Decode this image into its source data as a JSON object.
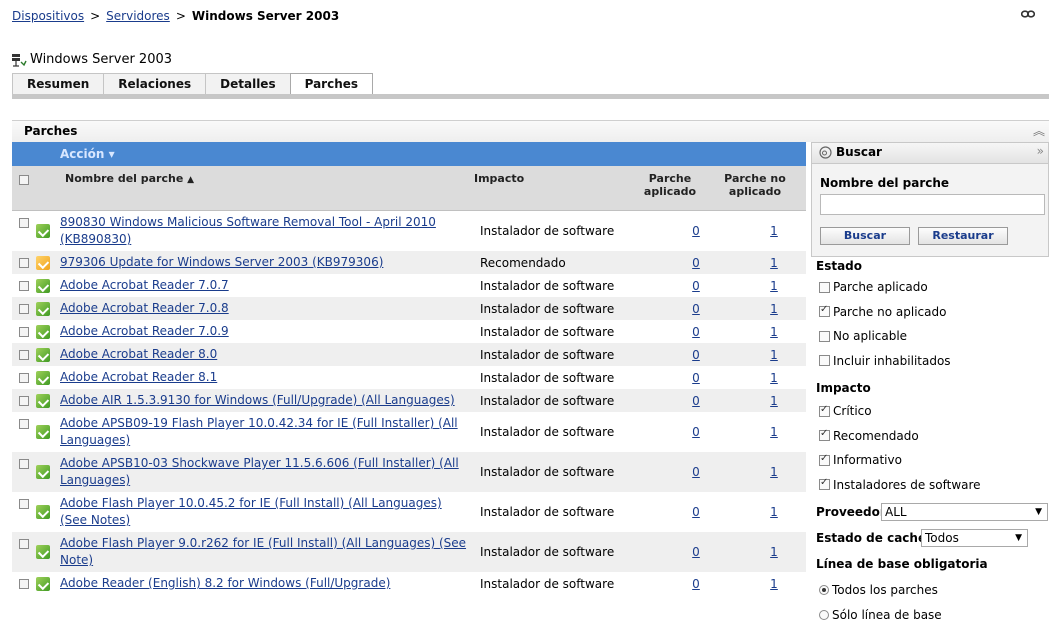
{
  "breadcrumb": {
    "item1": "Dispositivos",
    "item2": "Servidores",
    "current": "Windows Server 2003",
    "sep": ">"
  },
  "device": {
    "title": "Windows Server 2003"
  },
  "tabs": [
    "Resumen",
    "Relaciones",
    "Detalles",
    "Parches"
  ],
  "active_tab": "Parches",
  "panel": {
    "title": "Parches"
  },
  "table": {
    "action_label": "Acción ▾",
    "columns": {
      "name": "Nombre del parche",
      "sort": "▲",
      "impact": "Impacto",
      "applied": "Parche aplicado",
      "not_applied": "Parche no aplicado"
    },
    "rows": [
      {
        "name": "890830 Windows Malicious Software Removal Tool - April 2010 (KB890830)",
        "impact": "Instalador de software",
        "applied": "0",
        "not_applied": "1",
        "icon": "green"
      },
      {
        "name": "979306 Update for Windows Server 2003 (KB979306)",
        "impact": "Recomendado",
        "applied": "0",
        "not_applied": "1",
        "icon": "orange"
      },
      {
        "name": "Adobe Acrobat Reader 7.0.7",
        "impact": "Instalador de software",
        "applied": "0",
        "not_applied": "1",
        "icon": "green"
      },
      {
        "name": "Adobe Acrobat Reader 7.0.8",
        "impact": "Instalador de software",
        "applied": "0",
        "not_applied": "1",
        "icon": "green"
      },
      {
        "name": "Adobe Acrobat Reader 7.0.9",
        "impact": "Instalador de software",
        "applied": "0",
        "not_applied": "1",
        "icon": "green"
      },
      {
        "name": "Adobe Acrobat Reader 8.0",
        "impact": "Instalador de software",
        "applied": "0",
        "not_applied": "1",
        "icon": "green"
      },
      {
        "name": "Adobe Acrobat Reader 8.1",
        "impact": "Instalador de software",
        "applied": "0",
        "not_applied": "1",
        "icon": "green"
      },
      {
        "name": "Adobe AIR 1.5.3.9130 for Windows (Full/Upgrade) (All Languages)",
        "impact": "Instalador de software",
        "applied": "0",
        "not_applied": "1",
        "icon": "green"
      },
      {
        "name": "Adobe APSB09-19 Flash Player 10.0.42.34 for IE (Full Installer) (All Languages)",
        "impact": "Instalador de software",
        "applied": "0",
        "not_applied": "1",
        "icon": "green"
      },
      {
        "name": "Adobe APSB10-03 Shockwave Player 11.5.6.606 (Full Installer) (All Languages)",
        "impact": "Instalador de software",
        "applied": "0",
        "not_applied": "1",
        "icon": "green"
      },
      {
        "name": "Adobe Flash Player 10.0.45.2 for IE (Full Install) (All Languages) (See Notes)",
        "impact": "Instalador de software",
        "applied": "0",
        "not_applied": "1",
        "icon": "green"
      },
      {
        "name": "Adobe Flash Player 9.0.r262 for IE (Full Install) (All Languages) (See Note)",
        "impact": "Instalador de software",
        "applied": "0",
        "not_applied": "1",
        "icon": "green"
      },
      {
        "name": "Adobe Reader (English) 8.2 for Windows (Full/Upgrade)",
        "impact": "Instalador de software",
        "applied": "0",
        "not_applied": "1",
        "icon": "green"
      }
    ]
  },
  "search": {
    "title": "Buscar",
    "name_label": "Nombre del parche",
    "name_value": "",
    "btn_search": "Buscar",
    "btn_reset": "Restaurar",
    "estado_label": "Estado",
    "estado": [
      {
        "label": "Parche aplicado",
        "checked": false
      },
      {
        "label": "Parche no aplicado",
        "checked": true
      },
      {
        "label": "No aplicable",
        "checked": false
      },
      {
        "label": "Incluir inhabilitados",
        "checked": false
      }
    ],
    "impacto_label": "Impacto",
    "impacto": [
      {
        "label": "Crítico",
        "checked": true
      },
      {
        "label": "Recomendado",
        "checked": true
      },
      {
        "label": "Informativo",
        "checked": true
      },
      {
        "label": "Instaladores de software",
        "checked": true
      }
    ],
    "proveedor_label": "Proveedor",
    "proveedor_value": "ALL",
    "cache_label": "Estado de caché",
    "cache_value": "Todos",
    "baseline_label": "Línea de base obligatoria",
    "baseline": [
      {
        "label": "Todos los parches",
        "selected": true
      },
      {
        "label": "Sólo línea de base",
        "selected": false
      }
    ]
  }
}
